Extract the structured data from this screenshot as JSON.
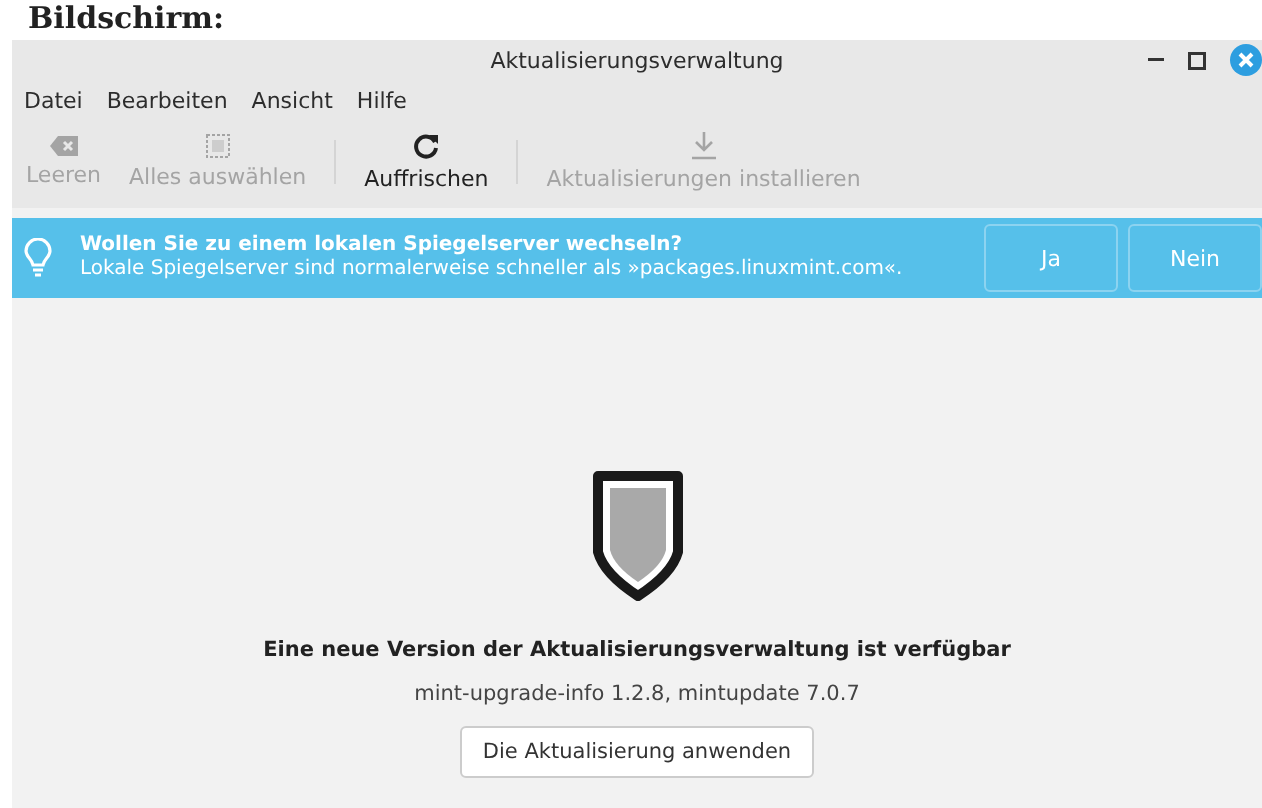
{
  "page_heading": "Bildschirm:",
  "window": {
    "title": "Aktualisierungsverwaltung"
  },
  "menu": [
    "Datei",
    "Bearbeiten",
    "Ansicht",
    "Hilfe"
  ],
  "toolbar": [
    {
      "label": "Leeren",
      "kind": "clear",
      "disabled": true
    },
    {
      "label": "Alles auswählen",
      "kind": "select",
      "disabled": true
    },
    {
      "label": "Auffrischen",
      "kind": "refresh",
      "disabled": false
    },
    {
      "label": "Aktualisierungen installieren",
      "kind": "install",
      "disabled": true
    }
  ],
  "banner": {
    "title": "Wollen Sie zu einem lokalen Spiegelserver wechseln?",
    "message": "Lokale Spiegelserver sind normalerweise schneller als »packages.linuxmint.com«.",
    "buttons": [
      "Ja",
      "Nein"
    ]
  },
  "content": {
    "heading": "Eine neue Version der Aktualisierungsverwaltung ist verfügbar",
    "details": "mint-upgrade-info 1.2.8, mintupdate 7.0.7",
    "button": "Die Aktualisierung anwenden"
  }
}
